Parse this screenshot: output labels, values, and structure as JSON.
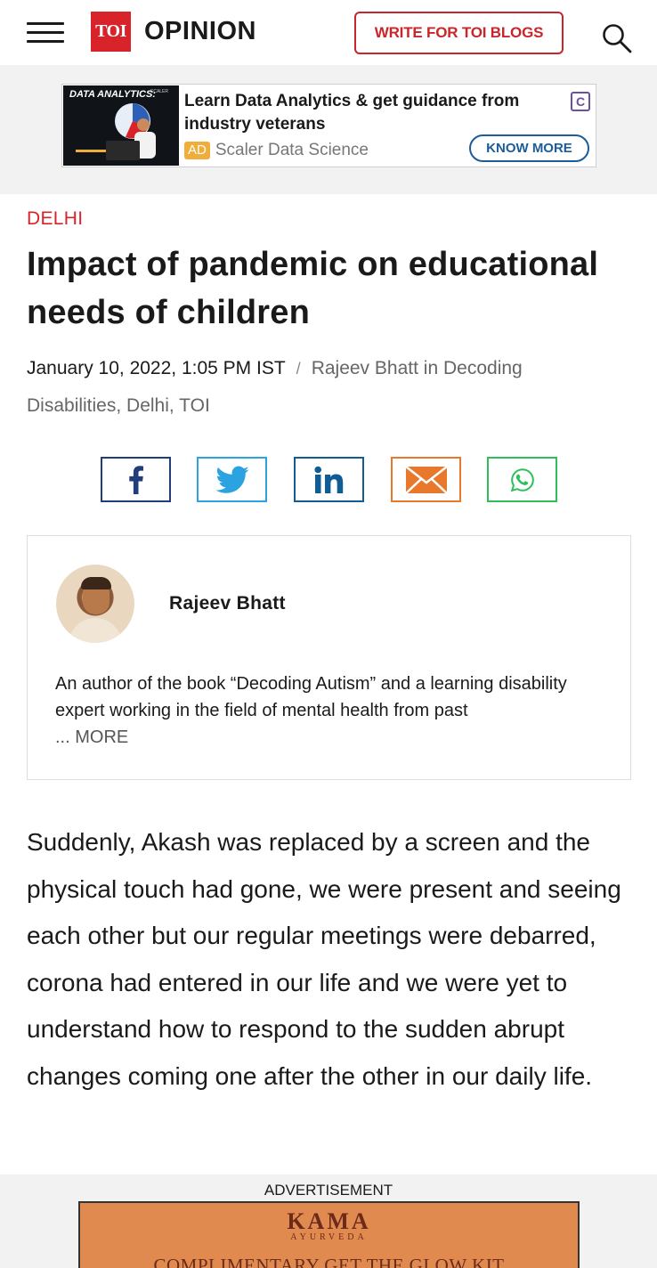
{
  "header": {
    "logo_text": "TOI",
    "section": "OPINION",
    "write_button": "WRITE FOR TOI BLOGS",
    "brand_color": "#d8232a"
  },
  "top_ad": {
    "image_title": "DATA ANALYTICS:",
    "image_brand": "SCALER",
    "headline": "Learn Data Analytics & get guidance from industry veterans",
    "tag": "AD",
    "sponsor": "Scaler Data Science",
    "cta": "KNOW MORE",
    "choice_icon": "C"
  },
  "article": {
    "category": "DELHI",
    "headline": "Impact of pandemic on educational needs of children",
    "date": "January 10, 2022, 1:05 PM IST",
    "separator": "/",
    "byline_author": "Rajeev Bhatt",
    "byline_in": "in",
    "byline_blog": "Decoding Disabilities, Delhi, TOI"
  },
  "share": {
    "icons": [
      "facebook-icon",
      "twitter-icon",
      "linkedin-icon",
      "email-icon",
      "whatsapp-icon"
    ],
    "colors": {
      "facebook": "#1f3e7a",
      "twitter": "#2aa3e0",
      "linkedin": "#0f5d94",
      "email": "#e8792c",
      "whatsapp": "#2fbf5a"
    }
  },
  "author_card": {
    "name": "Rajeev Bhatt",
    "bio": "An author of the book “Decoding Autism” and a learning disability expert working in the field of mental health from past",
    "more": "... MORE"
  },
  "body": {
    "paragraph": "Suddenly, Akash was replaced by a screen and the physical touch had gone, we were present and seeing each other but our regular meetings were debarred, corona had entered in our life and we were yet to understand how to respond to the sudden abrupt changes coming one after the other in our daily life."
  },
  "bottom_ad": {
    "label": "ADVERTISEMENT",
    "brand": "KAMA",
    "brand_sub": "AYURVEDA",
    "promo": "COMPLIMENTARY GET THE GLOW KIT"
  }
}
